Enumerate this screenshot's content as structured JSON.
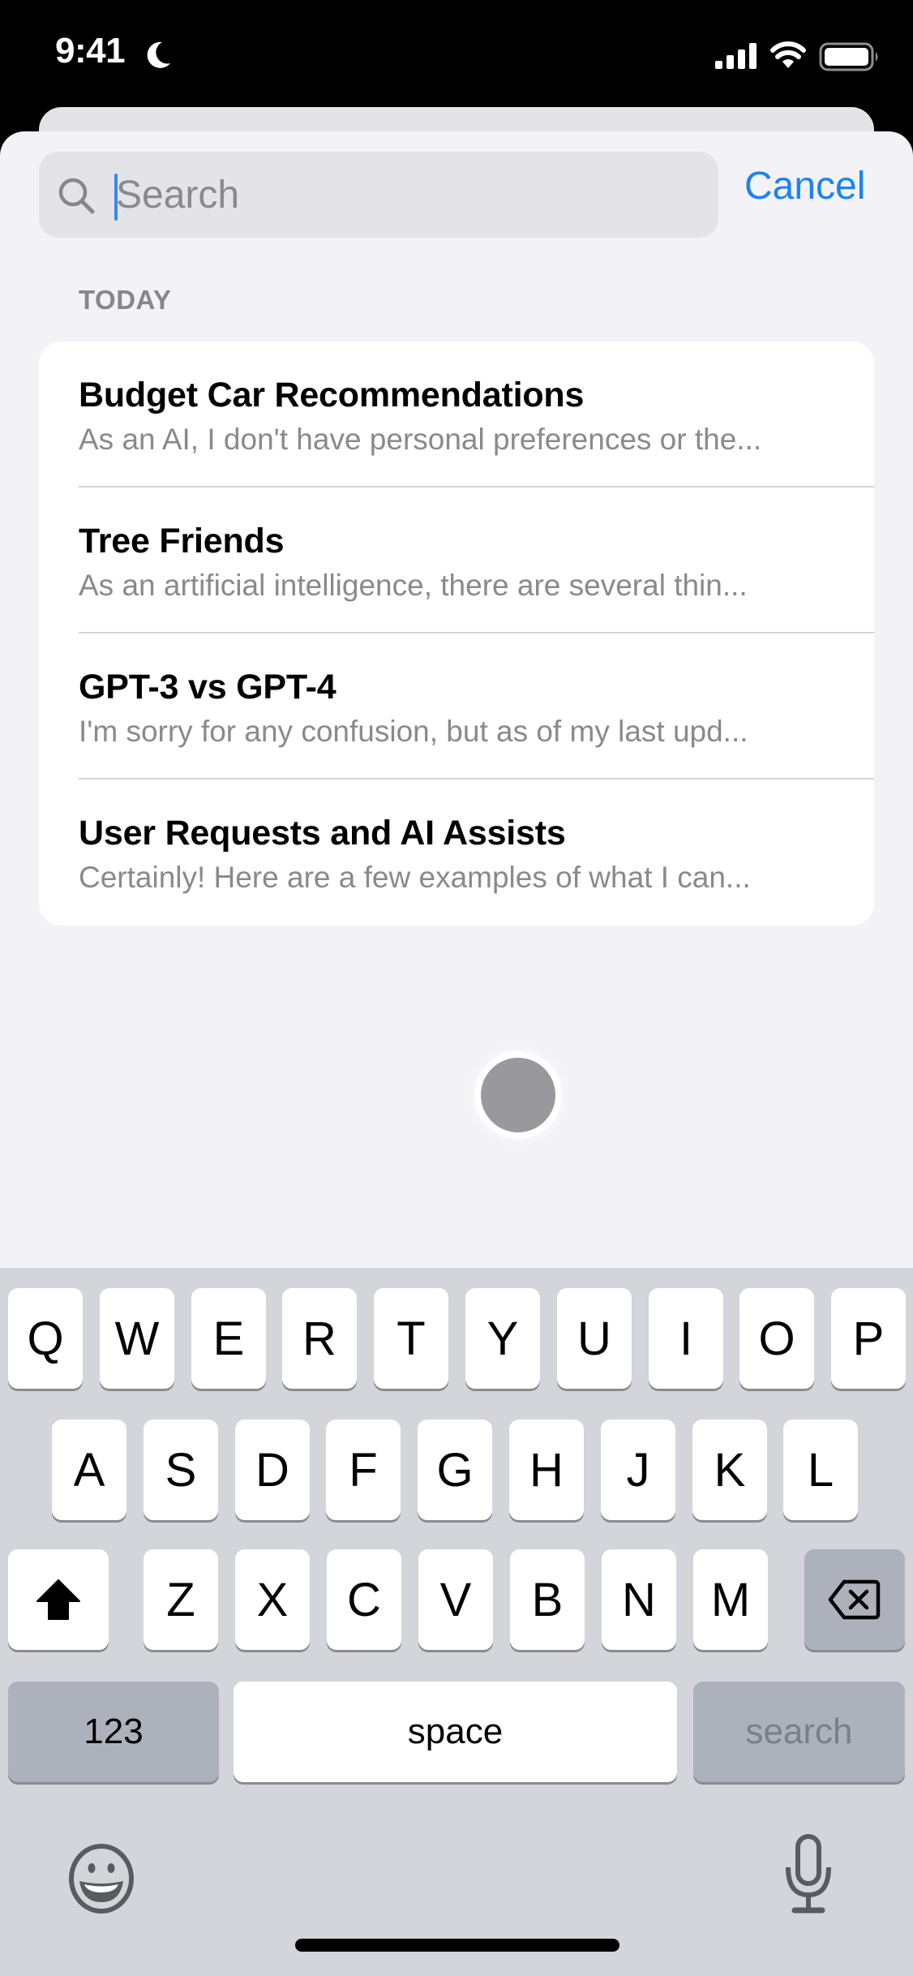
{
  "status_bar": {
    "time": "9:41",
    "focus_icon": "moon-icon",
    "signal_icon": "cellular-signal-icon",
    "wifi_icon": "wifi-icon",
    "battery_icon": "battery-icon"
  },
  "search": {
    "placeholder": "Search",
    "value": "",
    "cancel_label": "Cancel"
  },
  "section": {
    "header": "TODAY"
  },
  "conversations": [
    {
      "title": "Budget Car Recommendations",
      "preview": "As an AI, I don't have personal preferences or the..."
    },
    {
      "title": "Tree Friends",
      "preview": "As an artificial intelligence, there are several thin..."
    },
    {
      "title": "GPT-3 vs GPT-4",
      "preview": "I'm sorry for any confusion, but as of my last upd..."
    },
    {
      "title": "User Requests and AI Assists",
      "preview": "Certainly! Here are a few examples of what I can..."
    }
  ],
  "keyboard": {
    "row1": [
      "Q",
      "W",
      "E",
      "R",
      "T",
      "Y",
      "U",
      "I",
      "O",
      "P"
    ],
    "row2": [
      "A",
      "S",
      "D",
      "F",
      "G",
      "H",
      "J",
      "K",
      "L"
    ],
    "row3": [
      "Z",
      "X",
      "C",
      "V",
      "B",
      "N",
      "M"
    ],
    "numbers_label": "123",
    "space_label": "space",
    "return_label": "search",
    "shift_icon": "shift-icon",
    "delete_icon": "delete-icon",
    "emoji_icon": "emoji-icon",
    "mic_icon": "microphone-icon"
  },
  "colors": {
    "accent": "#1a82f7",
    "sheet_background": "#f2f2f7",
    "keyboard_background": "#d3d5db",
    "secondary_text": "#8a8a8e"
  }
}
